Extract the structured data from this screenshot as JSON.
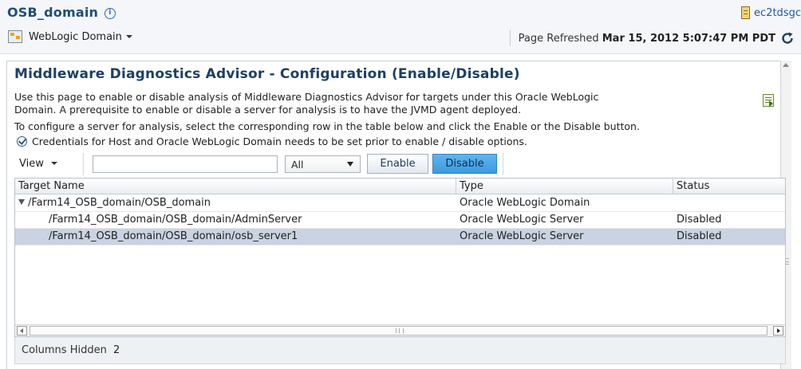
{
  "header": {
    "domain_title": "OSB_domain",
    "host_text": "ec2tdsgc",
    "domain_menu_label": "WebLogic Domain",
    "refresh_label": "Page Refreshed",
    "refresh_time": "Mar 15, 2012 5:07:47 PM PDT"
  },
  "main": {
    "title": "Middleware Diagnostics Advisor - Configuration (Enable/Disable)",
    "description": [
      "Use this page to enable or disable analysis of Middleware Diagnostics Advisor for targets under this Oracle WebLogic",
      "Domain. A prerequisite to enable or disable a server for analysis is to have the JVMD agent deployed.",
      "To configure a server for analysis, select the corresponding row in the table below and click the Enable or the Disable button."
    ],
    "credentials_note": "Credentials for Host and Oracle WebLogic Domain needs to be set prior to enable / disable options."
  },
  "toolbar": {
    "view_label": "View",
    "search_value": "",
    "select_value": "All",
    "enable_label": "Enable",
    "disable_label": "Disable"
  },
  "table": {
    "columns": [
      "Target Name",
      "Type",
      "Status"
    ],
    "rows": [
      {
        "name": "/Farm14_OSB_domain/OSB_domain",
        "type": "Oracle WebLogic Domain",
        "status": ""
      },
      {
        "name": "/Farm14_OSB_domain/OSB_domain/AdminServer",
        "type": "Oracle WebLogic Server",
        "status": "Disabled"
      },
      {
        "name": "/Farm14_OSB_domain/OSB_domain/osb_server1",
        "type": "Oracle WebLogic Server",
        "status": "Disabled"
      }
    ]
  },
  "footer": {
    "columns_hidden_label": "Columns Hidden",
    "columns_hidden_count": "2"
  },
  "colors": {
    "title_blue": "#1f4e79",
    "selected_row": "#c9d3e2",
    "disable_button": "#3b9ae0"
  },
  "icons": [
    "info-icon",
    "host-icon",
    "weblogic-domain-icon",
    "refresh-icon",
    "export-icon",
    "checkmark-icon",
    "tree-collapse-icon"
  ]
}
